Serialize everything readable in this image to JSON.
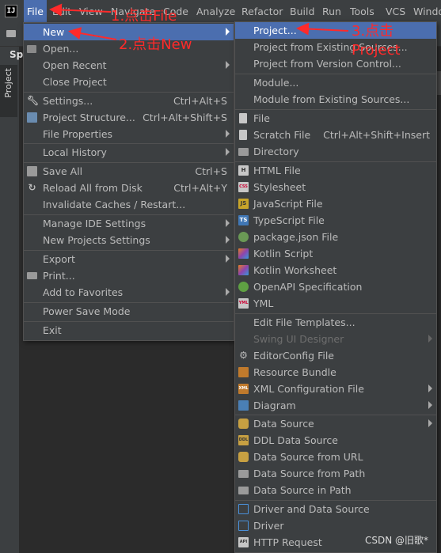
{
  "menubar": {
    "items": [
      "File",
      "Edit",
      "View",
      "Navigate",
      "Code",
      "Analyze",
      "Refactor",
      "Build",
      "Run",
      "Tools",
      "VCS",
      "Windo"
    ]
  },
  "sidebar": {
    "panel_label": "Sp",
    "project_tab": "Project"
  },
  "file_menu": {
    "items": [
      {
        "label": "New",
        "shortcut": "",
        "submenu": true
      },
      {
        "label": "Open...",
        "shortcut": ""
      },
      {
        "label": "Open Recent",
        "shortcut": "",
        "submenu": true
      },
      {
        "label": "Close Project",
        "shortcut": ""
      },
      {
        "label": "Settings...",
        "shortcut": "Ctrl+Alt+S"
      },
      {
        "label": "Project Structure...",
        "shortcut": "Ctrl+Alt+Shift+S"
      },
      {
        "label": "File Properties",
        "shortcut": "",
        "submenu": true
      },
      {
        "label": "Local History",
        "shortcut": "",
        "submenu": true
      },
      {
        "label": "Save All",
        "shortcut": "Ctrl+S"
      },
      {
        "label": "Reload All from Disk",
        "shortcut": "Ctrl+Alt+Y"
      },
      {
        "label": "Invalidate Caches / Restart...",
        "shortcut": ""
      },
      {
        "label": "Manage IDE Settings",
        "shortcut": "",
        "submenu": true
      },
      {
        "label": "New Projects Settings",
        "shortcut": "",
        "submenu": true
      },
      {
        "label": "Export",
        "shortcut": "",
        "submenu": true
      },
      {
        "label": "Print...",
        "shortcut": ""
      },
      {
        "label": "Add to Favorites",
        "shortcut": "",
        "submenu": true
      },
      {
        "label": "Power Save Mode",
        "shortcut": ""
      },
      {
        "label": "Exit",
        "shortcut": ""
      }
    ]
  },
  "new_menu": {
    "items": [
      {
        "label": "Project..."
      },
      {
        "label": "Project from Existing Sources..."
      },
      {
        "label": "Project from Version Control..."
      },
      {
        "label": "Module..."
      },
      {
        "label": "Module from Existing Sources..."
      },
      {
        "label": "File"
      },
      {
        "label": "Scratch File",
        "shortcut": "Ctrl+Alt+Shift+Insert"
      },
      {
        "label": "Directory"
      },
      {
        "label": "HTML File"
      },
      {
        "label": "Stylesheet"
      },
      {
        "label": "JavaScript File"
      },
      {
        "label": "TypeScript File"
      },
      {
        "label": "package.json File"
      },
      {
        "label": "Kotlin Script"
      },
      {
        "label": "Kotlin Worksheet"
      },
      {
        "label": "OpenAPI Specification"
      },
      {
        "label": "YML"
      },
      {
        "label": "Edit File Templates..."
      },
      {
        "label": "Swing UI Designer"
      },
      {
        "label": "EditorConfig File"
      },
      {
        "label": "Resource Bundle"
      },
      {
        "label": "XML Configuration File"
      },
      {
        "label": "Diagram"
      },
      {
        "label": "Data Source"
      },
      {
        "label": "DDL Data Source"
      },
      {
        "label": "Data Source from URL"
      },
      {
        "label": "Data Source from Path"
      },
      {
        "label": "Data Source in Path"
      },
      {
        "label": "Driver and Data Source"
      },
      {
        "label": "Driver"
      },
      {
        "label": "HTTP Request"
      }
    ]
  },
  "icon_labels": {
    "html": "H",
    "css": "CSS",
    "js": "JS",
    "ts": "TS",
    "xml": "XML",
    "ddl": "DDL",
    "api": "API",
    "yml": "YML"
  },
  "annotations": {
    "step1": "1.点击File",
    "step2": "2.点击New",
    "step3a": "3.点击",
    "step3b": "Project"
  },
  "watermark": "CSDN @旧歌*",
  "colors": {
    "accent": "#4b6eaf",
    "annotation": "#ff2a2a",
    "menu_bg": "#3c3f41"
  }
}
